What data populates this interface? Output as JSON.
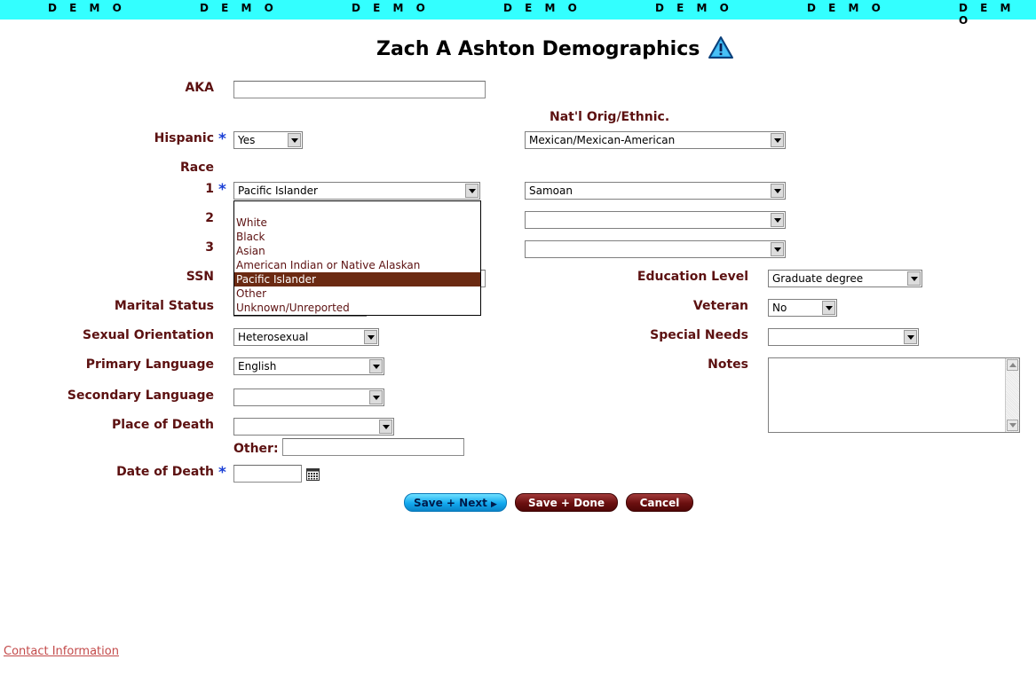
{
  "banner": {
    "text": "D E M O"
  },
  "title": "Zach A Ashton Demographics",
  "fields": {
    "aka": {
      "label": "AKA",
      "value": ""
    },
    "natl_orig_heading": "Nat'l Orig/Ethnic.",
    "hispanic": {
      "label": "Hispanic",
      "value": "Yes"
    },
    "hispanic_origin": {
      "value": "Mexican/Mexican-American"
    },
    "race": {
      "label": "Race",
      "rows": [
        {
          "label": "1",
          "value": "Pacific Islander",
          "sub_value": "Samoan"
        },
        {
          "label": "2",
          "value": "",
          "sub_value": ""
        },
        {
          "label": "3",
          "value": "",
          "sub_value": ""
        }
      ],
      "open_dropdown": {
        "options": [
          "",
          "White",
          "Black",
          "Asian",
          "American Indian or Native Alaskan",
          "Pacific Islander",
          "Other",
          "Unknown/Unreported"
        ],
        "selected": "Pacific Islander"
      }
    },
    "ssn": {
      "label": "SSN"
    },
    "marital_status": {
      "label": "Marital Status"
    },
    "sexual_orientation": {
      "label": "Sexual Orientation",
      "value": "Heterosexual"
    },
    "primary_language": {
      "label": "Primary Language",
      "value": "English"
    },
    "secondary_language": {
      "label": "Secondary Language",
      "value": ""
    },
    "place_of_death": {
      "label": "Place of Death",
      "value": ""
    },
    "other": {
      "label": "Other:",
      "value": ""
    },
    "date_of_death": {
      "label": "Date of Death",
      "value": ""
    },
    "education_level": {
      "label": "Education Level",
      "value": "Graduate degree"
    },
    "veteran": {
      "label": "Veteran",
      "value": "No"
    },
    "special_needs": {
      "label": "Special Needs",
      "value": ""
    },
    "notes": {
      "label": "Notes",
      "value": ""
    }
  },
  "buttons": {
    "save_next": "Save + Next",
    "save_done": "Save + Done",
    "cancel": "Cancel"
  },
  "footer": {
    "contact_link": "Contact Information"
  },
  "colors": {
    "banner": "#33ffff",
    "label": "#5c1111",
    "required": "#1a3fd6",
    "selected_option": "#6b2a12"
  },
  "icons": {
    "title": "warning-icon",
    "date_picker": "calendar-icon",
    "button_arrow": "arrow-right-icon"
  }
}
